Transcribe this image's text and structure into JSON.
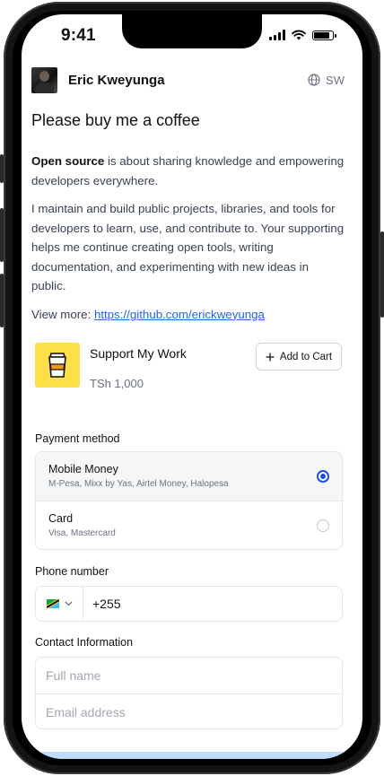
{
  "status_bar": {
    "time": "9:41"
  },
  "header": {
    "name": "Eric Kweyunga",
    "language": "SW"
  },
  "page": {
    "title": "Please buy me a coffee",
    "intro_bold": "Open source",
    "intro_rest": " is about sharing knowledge and empowering developers everywhere.",
    "paragraph2": "I maintain and build public projects, libraries, and tools for developers to learn, use, and contribute to. Your supporting helps me continue creating open tools, writing documentation, and experimenting with new ideas in public.",
    "view_more_label": "View more: ",
    "view_more_link": "https://github.com/erickweyunga"
  },
  "product": {
    "name": "Support My Work",
    "price": "TSh 1,000",
    "add_to_cart": "Add to Cart"
  },
  "payment": {
    "label": "Payment method",
    "options": [
      {
        "title": "Mobile Money",
        "subtitle": "M-Pesa, Mixx by Yas, Airtel Money, Halopesa",
        "selected": true
      },
      {
        "title": "Card",
        "subtitle": "Visa, Mastercard",
        "selected": false
      }
    ]
  },
  "phone": {
    "label": "Phone number",
    "value": "+255"
  },
  "contact": {
    "label": "Contact Information",
    "full_name_placeholder": "Full name",
    "email_placeholder": "Email address"
  },
  "colors": {
    "accent": "#1d4ed8",
    "link": "#2563eb",
    "product_bg": "#fde047"
  }
}
